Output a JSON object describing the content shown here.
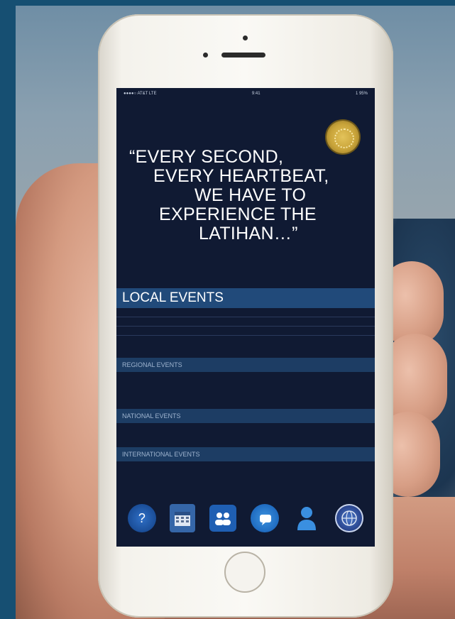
{
  "status_bar": {
    "carrier": "●●●●○ AT&T LTE",
    "time": "9:41",
    "battery": "1 95%"
  },
  "quote": {
    "lines": [
      "“EVERY SECOND,",
      "EVERY HEARTBEAT,",
      "WE HAVE TO",
      "EXPERIENCE THE",
      "LATIHAN…”"
    ]
  },
  "sections": {
    "local": {
      "title": "LOCAL EVENTS",
      "rows": [
        [
          "",
          "",
          "",
          ""
        ],
        [
          "",
          "",
          "",
          ""
        ],
        [
          "",
          "",
          "",
          ""
        ]
      ]
    },
    "regional": {
      "title": "REGIONAL EVENTS",
      "rows": [
        [
          "",
          "",
          "",
          "",
          ""
        ],
        [
          "",
          "",
          "",
          "",
          ""
        ]
      ]
    },
    "national": {
      "title": "NATIONAL EVENTS",
      "rows": [
        [
          "",
          "",
          ""
        ]
      ]
    },
    "international": {
      "title": "INTERNATIONAL EVENTS",
      "rows": [
        [
          ""
        ]
      ]
    }
  },
  "dock": {
    "icons": [
      "help-icon",
      "calendar-icon",
      "group-icon",
      "chat-icon",
      "person-icon",
      "globe-icon"
    ]
  },
  "colors": {
    "screen_bg": "#101a33",
    "section_header": "#214a7a",
    "emblem_gold": "#c9a43a",
    "backdrop": "#164f72"
  }
}
